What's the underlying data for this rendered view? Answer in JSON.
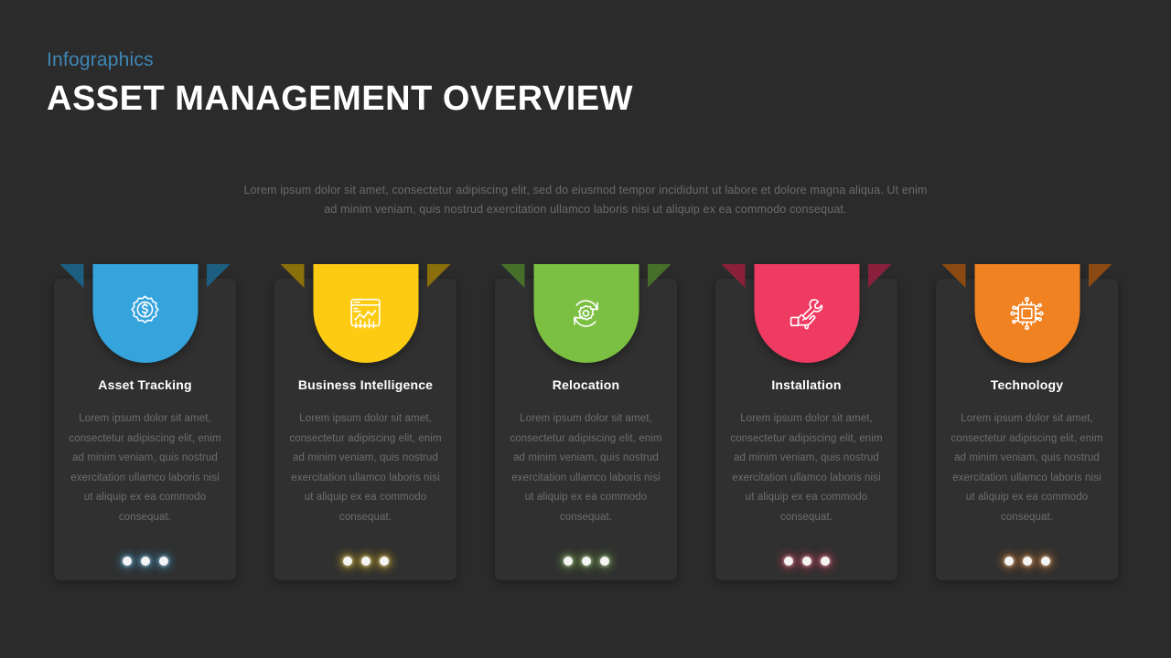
{
  "header": {
    "eyebrow": "Infographics",
    "title": "ASSET MANAGEMENT OVERVIEW",
    "eyebrow_color": "#3f87b5",
    "title_color": "#ffffff"
  },
  "intro": {
    "line1": "Lorem ipsum dolor sit amet, consectetur adipiscing elit, sed do eiusmod tempor incididunt ut labore et dolore magna aliqua.  Ut enim",
    "line2": "ad minim veniam, quis nostrud exercitation ullamco laboris nisi ut aliquip ex ea commodo consequat."
  },
  "theme": {
    "page_background": "#2b2b2b",
    "card_background": "#303030",
    "body_text_color": "#6e6e6e",
    "dot_color": "#f4f4f4"
  },
  "cards": [
    {
      "title": "Asset Tracking",
      "body": "Lorem ipsum dolor sit amet, consectetur adipiscing elit, enim ad minim veniam, quis nostrud exercitation ullamco laboris nisi ut aliquip ex ea commodo consequat.",
      "color": "#35a3dc",
      "wing_color": "#1d5f81",
      "icon": "gear-dollar-icon",
      "dots": 3
    },
    {
      "title": "Business Intelligence",
      "body": "Lorem ipsum dolor sit amet, consectetur adipiscing elit, enim ad minim veniam, quis nostrud exercitation ullamco laboris nisi ut aliquip ex ea commodo consequat.",
      "color": "#fdcb12",
      "wing_color": "#8a6f0a",
      "icon": "analytics-window-icon",
      "dots": 3
    },
    {
      "title": "Relocation",
      "body": "Lorem ipsum dolor sit amet, consectetur adipiscing elit, enim ad minim veniam, quis nostrud exercitation ullamco laboris nisi ut aliquip ex ea commodo consequat.",
      "color": "#7cc043",
      "wing_color": "#46702a",
      "icon": "refresh-gear-icon",
      "dots": 3
    },
    {
      "title": "Installation",
      "body": "Lorem ipsum dolor sit amet, consectetur adipiscing elit, enim ad minim veniam, quis nostrud exercitation ullamco laboris nisi ut aliquip ex ea commodo consequat.",
      "color": "#ef3a62",
      "wing_color": "#8a2039",
      "icon": "hand-wrench-icon",
      "dots": 3
    },
    {
      "title": "Technology",
      "body": "Lorem ipsum dolor sit amet, consectetur adipiscing elit, enim ad minim veniam, quis nostrud exercitation ullamco laboris nisi ut aliquip ex ea commodo consequat.",
      "color": "#f08222",
      "wing_color": "#8a4a12",
      "icon": "microchip-icon",
      "dots": 3
    }
  ]
}
